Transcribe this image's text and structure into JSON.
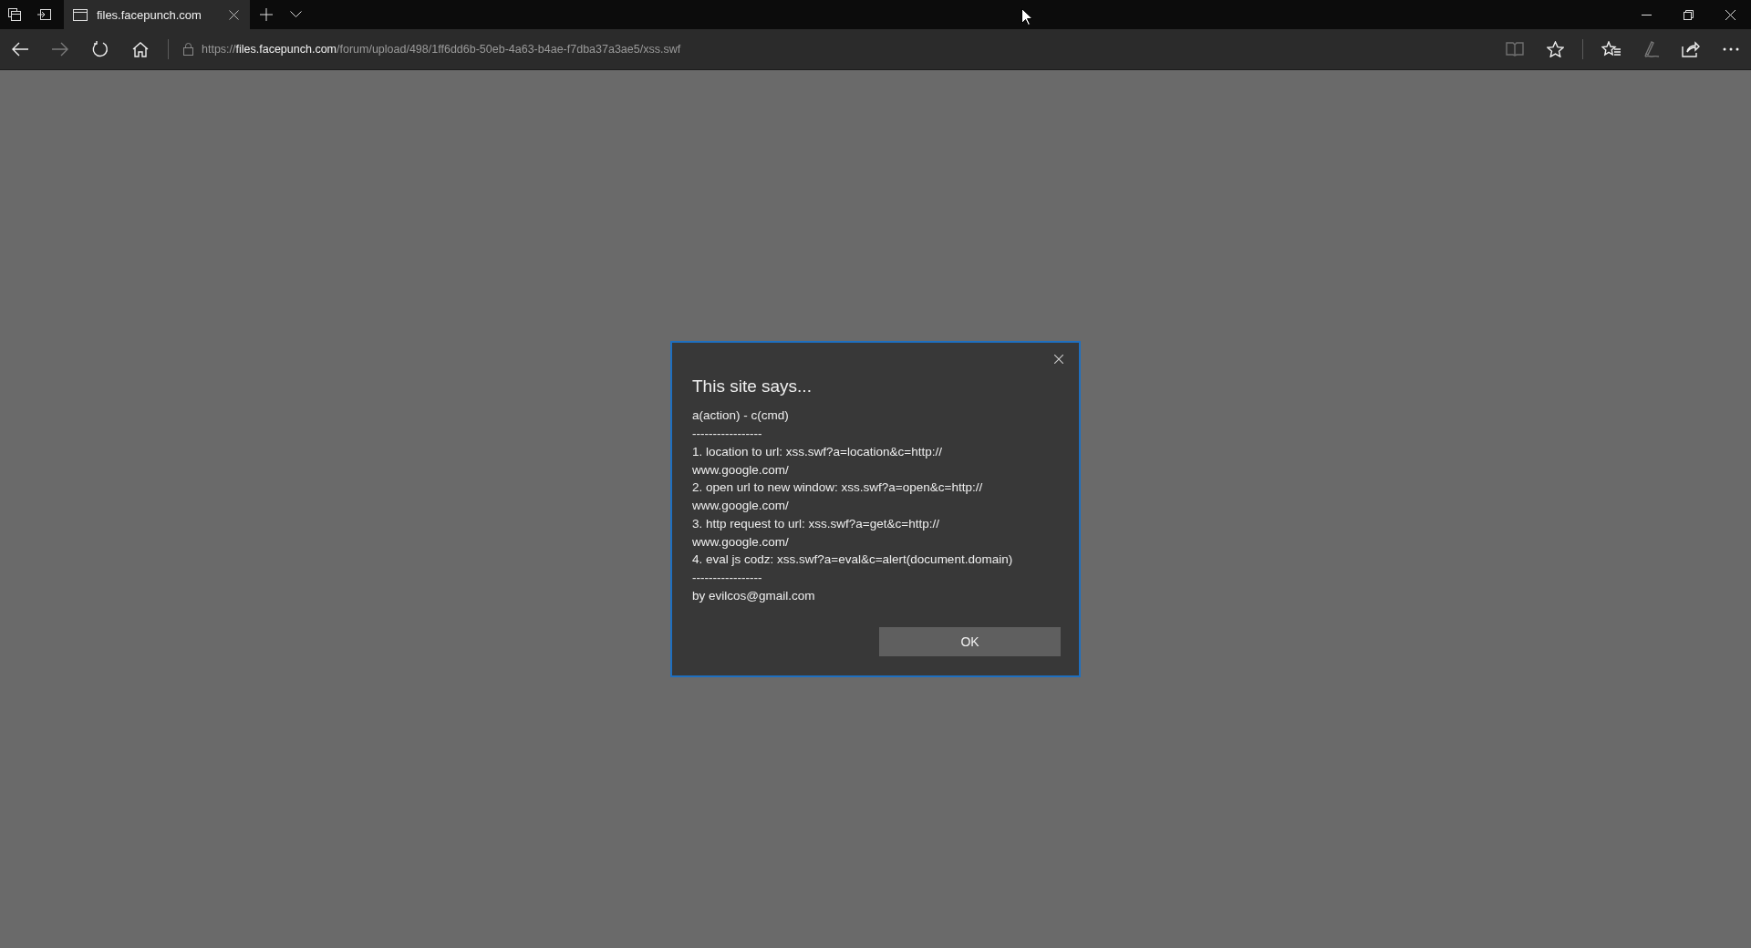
{
  "tab": {
    "title": "files.facepunch.com",
    "selected": true
  },
  "toolbar": {
    "back_disabled": false,
    "forward_disabled": true,
    "reading_view_disabled": true
  },
  "address": {
    "scheme": "https://",
    "host": "files.facepunch.com",
    "path": "/forum/upload/498/1ff6dd6b-50eb-4a63-b4ae-f7dba37a3ae5/xss.swf"
  },
  "dialog": {
    "title": "This site says...",
    "lines": [
      "a(action) - c(cmd)",
      "-----------------",
      "1. location to url: xss.swf?a=location&c=http://",
      "www.google.com/",
      "2. open url to new window: xss.swf?a=open&c=http://",
      "www.google.com/",
      "3. http request to url: xss.swf?a=get&c=http://",
      "www.google.com/",
      "4. eval js codz: xss.swf?a=eval&c=alert(document.domain)",
      "-----------------",
      "by evilcos@gmail.com"
    ],
    "ok_button": "OK"
  }
}
